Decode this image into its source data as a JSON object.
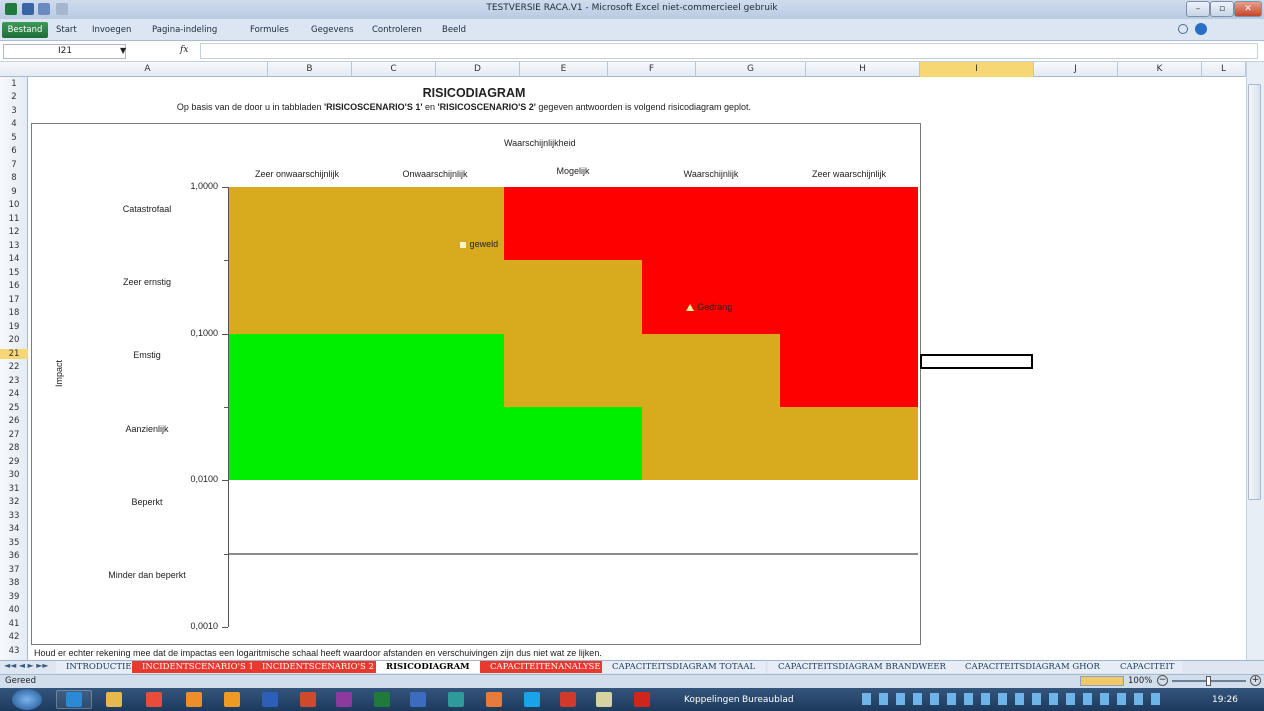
{
  "window": {
    "title": "TESTVERSIE RACA.V1  -  Microsoft Excel niet-commercieel gebruik"
  },
  "ribbon": {
    "tabs": [
      "Bestand",
      "Start",
      "Invoegen",
      "Pagina-indeling",
      "Formules",
      "Gegevens",
      "Controleren",
      "Beeld"
    ]
  },
  "formula": {
    "namebox": "I21",
    "fx": "fx",
    "value": ""
  },
  "columns": [
    "A",
    "B",
    "C",
    "D",
    "E",
    "F",
    "G",
    "H",
    "I",
    "J",
    "K",
    "L"
  ],
  "rows": [
    "1",
    "2",
    "3",
    "4",
    "5",
    "6",
    "7",
    "8",
    "9",
    "10",
    "11",
    "12",
    "13",
    "14",
    "15",
    "16",
    "17",
    "18",
    "19",
    "20",
    "21",
    "22",
    "23",
    "24",
    "25",
    "26",
    "27",
    "28",
    "29",
    "30",
    "31",
    "32",
    "33",
    "34",
    "35",
    "36",
    "37",
    "38",
    "39",
    "40",
    "41",
    "42",
    "43"
  ],
  "sheet": {
    "title": "RISICODIAGRAM",
    "subtitle_pre": "Op basis van de door u in tabbladen ",
    "subtitle_b1": "'RISICOSCENARIO'S 1'",
    "subtitle_mid": " en ",
    "subtitle_b2": "'RISICOSCENARIO'S 2'",
    "subtitle_post": " gegeven antwoorden is volgend risicodiagram geplot.",
    "footnote": "Houd er echter rekening mee dat de impactas een logaritmische schaal heeft waardoor afstanden en verschuivingen zijn dus niet wat ze lijken."
  },
  "chart_data": {
    "type": "scatter",
    "title": "Waarschijnlijkheid",
    "ylabel": "Impact",
    "yscale": "log",
    "ylim": [
      0.001,
      1
    ],
    "yticks": [
      "1,0000",
      "0,1000",
      "0,0100",
      "0,0010"
    ],
    "x_categories": [
      "Zeer onwaarschijnlijk",
      "Onwaarschijnlijk",
      "Mogelijk",
      "Waarschijnlijk",
      "Zeer waarschijnlijk"
    ],
    "y_categories": [
      "Catastrofaal",
      "Zeer ernstig",
      "Emstig",
      "Aanzienlijk",
      "Beperkt",
      "Minder dan beperkt"
    ],
    "zone_colors": {
      "orange": "#d8ab1e",
      "red": "#ff0000",
      "green": "#00ee00"
    },
    "points": [
      {
        "label": "geweld",
        "x": 2.2,
        "y": 0.4,
        "marker": "square"
      },
      {
        "label": "Gedrang",
        "x": 3.85,
        "y": 0.15,
        "marker": "triangle"
      }
    ]
  },
  "sheettabs": [
    "INTRODUCTIE",
    "INCIDENTSCENARIO'S 1",
    "INCIDENTSCENARIO'S 2",
    "RISICODIAGRAM",
    "CAPACITEITENANALYSE",
    "CAPACITEITSDIAGRAM TOTAAL",
    "CAPACITEITSDIAGRAM BRANDWEER",
    "CAPACITEITSDIAGRAM GHOR",
    "CAPACITEIT"
  ],
  "status": {
    "left": "Gereed",
    "zoom": "100%"
  },
  "taskbar": {
    "links": "Koppelingen",
    "desktop": "Bureaublad",
    "clock": "19:26"
  }
}
